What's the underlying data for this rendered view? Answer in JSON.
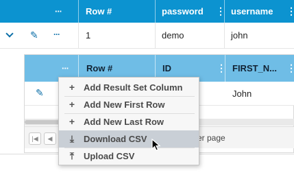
{
  "outer_grid": {
    "menu_dots": "···",
    "columns": [
      "Row #",
      "password",
      "username"
    ],
    "row": {
      "row_num": "1",
      "password": "demo",
      "username": "john"
    }
  },
  "inner_grid": {
    "menu_dots": "···",
    "columns": [
      "Row #",
      "ID",
      "FIRST_N..."
    ],
    "row": {
      "first_name": "John"
    },
    "pager_text": "er page"
  },
  "context_menu": {
    "items": [
      {
        "icon": "plus-icon",
        "glyph": "+",
        "label": "Add Result Set Column"
      },
      {
        "icon": "plus-icon",
        "glyph": "+",
        "label": "Add New First Row"
      },
      {
        "icon": "plus-icon",
        "glyph": "+",
        "label": "Add New Last Row"
      },
      {
        "icon": "download-icon",
        "glyph": "⤓",
        "label": "Download CSV"
      },
      {
        "icon": "upload-icon",
        "glyph": "⤒",
        "label": "Upload CSV"
      }
    ],
    "hovered_index": 3
  },
  "colors": {
    "outer_header": "#0c93d0",
    "inner_header": "#6fbde6",
    "menu_hover": "#c9cfd6"
  }
}
